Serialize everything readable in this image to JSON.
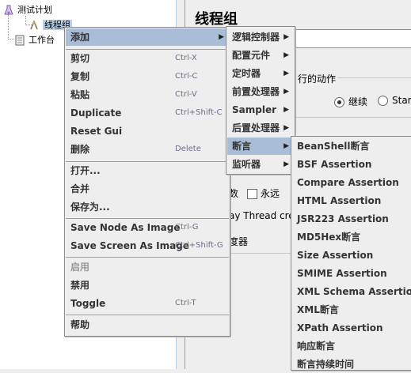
{
  "tree": {
    "root_label": "测试计划",
    "child_label": "线程组",
    "workbench_label": "工作台"
  },
  "right_panel": {
    "title": "线程组",
    "action_label": "行的动作",
    "continue_label": "继续",
    "start_label": "Star",
    "loop_label": "数",
    "forever_label": "永远",
    "delay_label": "ay Thread cre",
    "scheduler_label": "度器"
  },
  "context_menu": {
    "items": [
      {
        "label": "添加",
        "accel": "",
        "submenu": true
      },
      {
        "label": "剪切",
        "accel": "Ctrl-X"
      },
      {
        "label": "复制",
        "accel": "Ctrl-C"
      },
      {
        "label": "粘贴",
        "accel": "Ctrl-V"
      },
      {
        "label": "Duplicate",
        "accel": "Ctrl+Shift-C"
      },
      {
        "label": "Reset Gui",
        "accel": ""
      },
      {
        "label": "删除",
        "accel": "Delete"
      },
      {
        "label": "打开...",
        "accel": ""
      },
      {
        "label": "合并",
        "accel": ""
      },
      {
        "label": "保存为...",
        "accel": ""
      },
      {
        "label": "Save Node As Image",
        "accel": "Ctrl-G"
      },
      {
        "label": "Save Screen As Image",
        "accel": "Ctrl+Shift-G"
      },
      {
        "label": "启用",
        "accel": ""
      },
      {
        "label": "禁用",
        "accel": ""
      },
      {
        "label": "Toggle",
        "accel": "Ctrl-T"
      },
      {
        "label": "帮助",
        "accel": ""
      }
    ]
  },
  "add_submenu": {
    "items": [
      {
        "label": "逻辑控制器"
      },
      {
        "label": "配置元件"
      },
      {
        "label": "定时器"
      },
      {
        "label": "前置处理器"
      },
      {
        "label": "Sampler"
      },
      {
        "label": "后置处理器"
      },
      {
        "label": "断言"
      },
      {
        "label": "监听器"
      }
    ]
  },
  "assertion_submenu": {
    "items": [
      {
        "label": "BeanShell断言"
      },
      {
        "label": "BSF Assertion"
      },
      {
        "label": "Compare Assertion"
      },
      {
        "label": "HTML Assertion"
      },
      {
        "label": "JSR223 Assertion"
      },
      {
        "label": "MD5Hex断言"
      },
      {
        "label": "Size Assertion"
      },
      {
        "label": "SMIME Assertion"
      },
      {
        "label": "XML Schema Assertion"
      },
      {
        "label": "XML断言"
      },
      {
        "label": "XPath Assertion"
      },
      {
        "label": "响应断言"
      },
      {
        "label": "断言持续时间"
      }
    ]
  },
  "colors": {
    "highlight": "#a9bdd6",
    "menu_bg": "#eeeeee",
    "accel_text": "#6c6c8a",
    "disabled_text": "#999999"
  },
  "icons": {
    "arrow": "▶"
  }
}
